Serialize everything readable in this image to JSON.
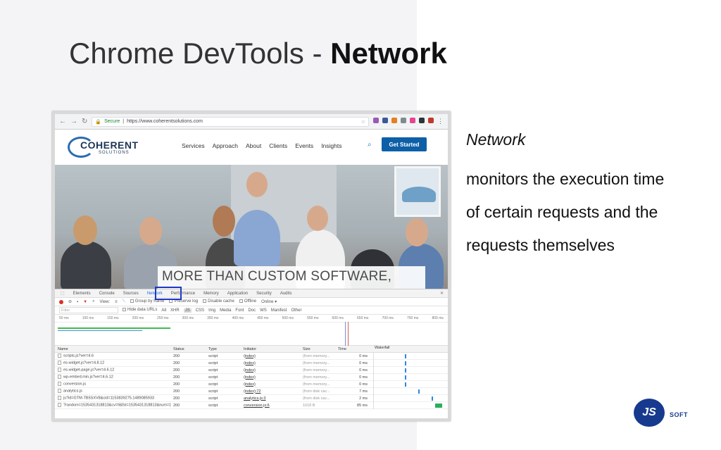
{
  "slide": {
    "title_plain": "Chrome DevTools - ",
    "title_bold": "Network",
    "side_heading": "Network",
    "side_lines": [
      "monitors the execution time",
      "of certain requests and the",
      "requests themselves"
    ]
  },
  "browser": {
    "secure_label": "Secure",
    "url": "https://www.coherentsolutions.com"
  },
  "site": {
    "logo_name": "COHERENT",
    "logo_sub": "SOLUTIONS",
    "nav": [
      "Services",
      "Approach",
      "About",
      "Clients",
      "Events",
      "Insights"
    ],
    "cta": "Get Started",
    "hero_text": "MORE THAN CUSTOM SOFTWARE,"
  },
  "devtools": {
    "tabs": [
      "Elements",
      "Console",
      "Sources",
      "Network",
      "Performance",
      "Memory",
      "Application",
      "Security",
      "Audits"
    ],
    "active_tab": "Network",
    "toolbar": {
      "view": "View:",
      "group_by_frame": "Group by frame",
      "preserve_log": "Preserve log",
      "disable_cache": "Disable cache",
      "offline": "Offline",
      "online": "Online"
    },
    "filter": {
      "placeholder": "Filter",
      "hide_data_urls": "Hide data URLs",
      "types": [
        "All",
        "XHR",
        "JS",
        "CSS",
        "Img",
        "Media",
        "Font",
        "Doc",
        "WS",
        "Manifest",
        "Other"
      ],
      "selected": "JS"
    },
    "timeline_ticks": [
      "50 ms",
      "100 ms",
      "150 ms",
      "200 ms",
      "250 ms",
      "300 ms",
      "350 ms",
      "400 ms",
      "450 ms",
      "500 ms",
      "550 ms",
      "600 ms",
      "650 ms",
      "700 ms",
      "750 ms",
      "800 ms"
    ],
    "columns": [
      "Name",
      "Status",
      "Type",
      "Initiator",
      "Size",
      "Time",
      "Waterfall"
    ],
    "rows": [
      {
        "name": "scripts.js?ver=4.6",
        "status": "200",
        "type": "script",
        "initiator": "(index)",
        "size": "(from memory...",
        "time": "0 ms",
        "wf": 0.42
      },
      {
        "name": "es-widget.js?ver=4.8.12",
        "status": "200",
        "type": "script",
        "initiator": "(index)",
        "size": "(from memory...",
        "time": "0 ms",
        "wf": 0.42
      },
      {
        "name": "es-widget-page.js?ver=4.6.12",
        "status": "200",
        "type": "script",
        "initiator": "(index)",
        "size": "(from memory...",
        "time": "0 ms",
        "wf": 0.42
      },
      {
        "name": "wp-embed.min.js?ver=4.6.12",
        "status": "200",
        "type": "script",
        "initiator": "(index)",
        "size": "(from memory...",
        "time": "0 ms",
        "wf": 0.42
      },
      {
        "name": "conversion.js",
        "status": "200",
        "type": "script",
        "initiator": "(index)",
        "size": "(from memory...",
        "time": "0 ms",
        "wf": 0.42
      },
      {
        "name": "analytics.js",
        "status": "200",
        "type": "script",
        "initiator": "(index):72",
        "size": "(from disk cac...",
        "time": "7 ms",
        "wf": 0.6
      },
      {
        "name": "js?id=GTM-TB5SXV8&cid=1153839275.1489085933",
        "status": "200",
        "type": "script",
        "initiator": "analytics.js:3",
        "size": "(from disk cac...",
        "time": "2 ms",
        "wf": 0.78
      },
      {
        "name": "?random=1535431318813&cv=9&fst=1535431318813&num=1",
        "status": "200",
        "type": "script",
        "initiator": "conversion.js:6",
        "size": "1018 B",
        "time": "85 ms",
        "wf": 0.83
      }
    ]
  },
  "brand": {
    "mark": "JS",
    "suffix": "SOFT"
  }
}
